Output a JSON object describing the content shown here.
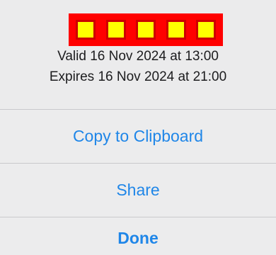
{
  "header": {
    "code_cells": 5,
    "valid_text": "Valid 16 Nov 2024 at 13:00",
    "expires_text": "Expires 16 Nov 2024 at 21:00"
  },
  "actions": {
    "copy_label": "Copy to Clipboard",
    "share_label": "Share",
    "done_label": "Done"
  },
  "colors": {
    "accent": "#1f86e8",
    "code_border": "#ff0000",
    "code_fill": "#ffff00"
  }
}
